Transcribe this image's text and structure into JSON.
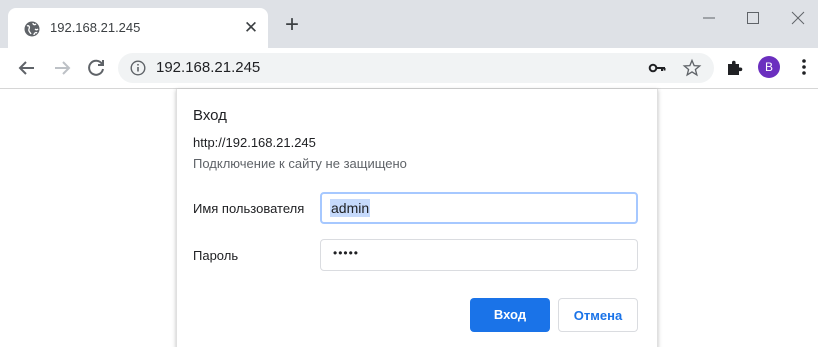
{
  "browser": {
    "tab": {
      "title": "192.168.21.245",
      "close_glyph": "✕",
      "favicon": "globe-icon"
    },
    "new_tab_glyph": "+",
    "omnibox": {
      "url": "192.168.21.245",
      "info_icon": "info-icon"
    },
    "profile_initial": "B",
    "colors": {
      "tabstrip": "#dee1e6",
      "avatar": "#6b2fbf",
      "accent": "#1a73e8"
    }
  },
  "dialog": {
    "title": "Вход",
    "url": "http://192.168.21.245",
    "warning": "Подключение к сайту не защищено",
    "username_label": "Имя пользователя",
    "username_value": "admin",
    "password_label": "Пароль",
    "password_value": "•••••",
    "login_label": "Вход",
    "cancel_label": "Отмена"
  }
}
